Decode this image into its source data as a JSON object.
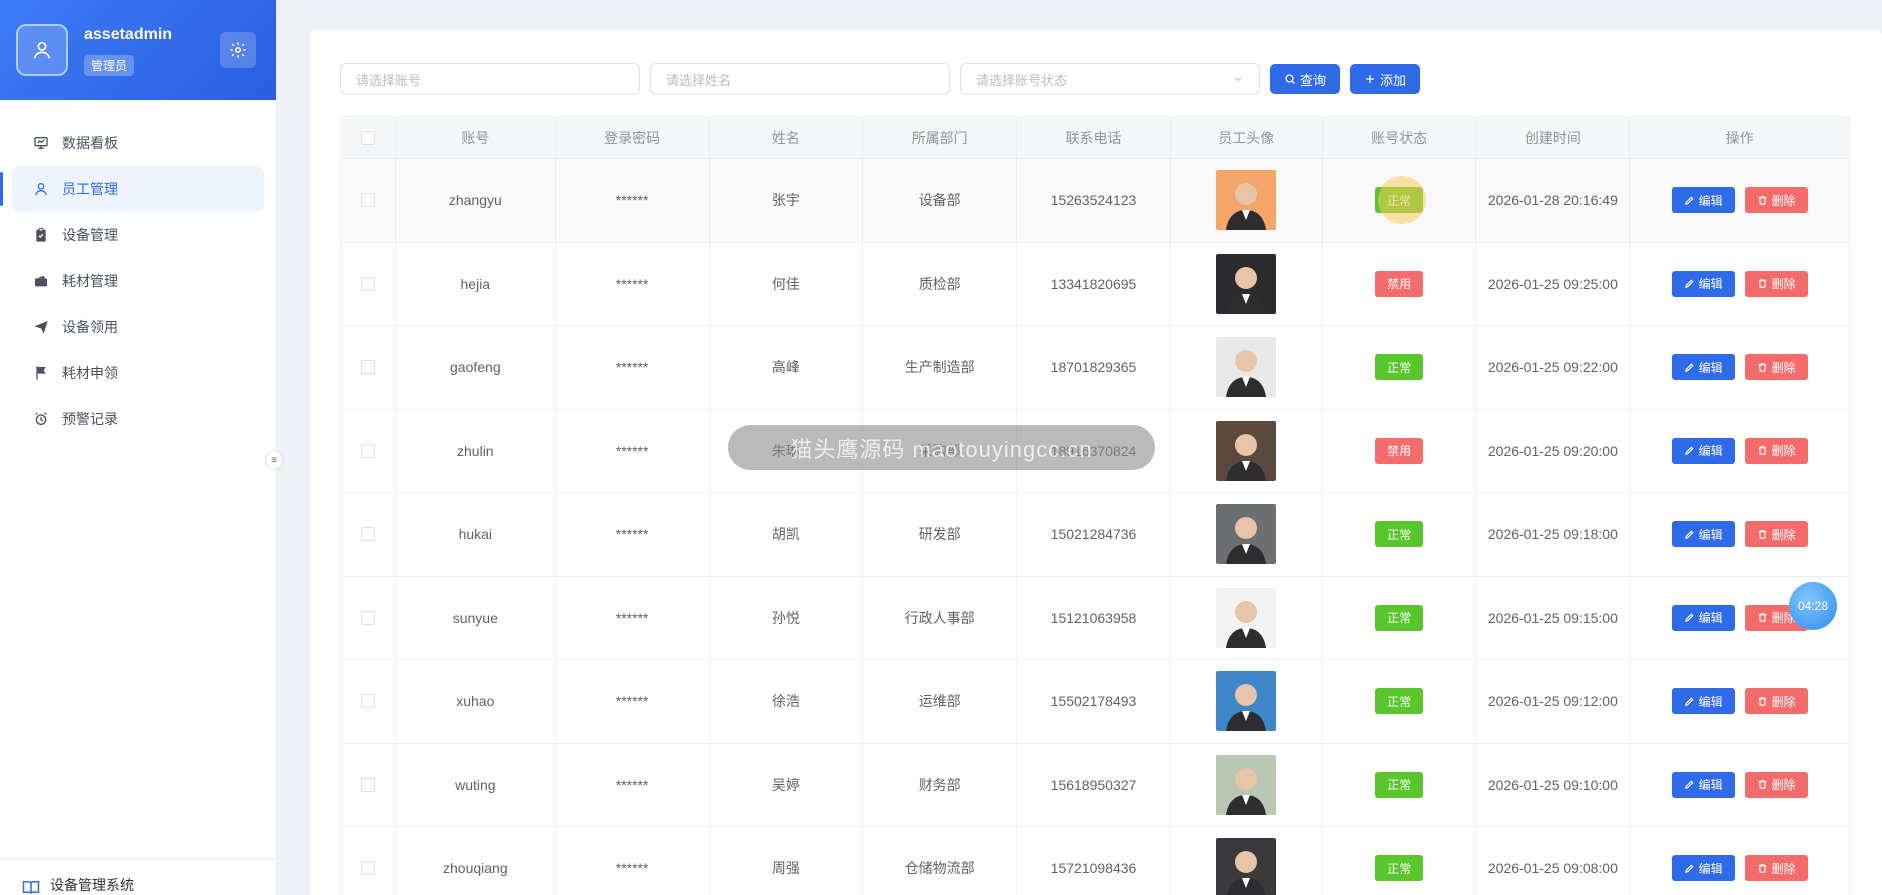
{
  "user": {
    "name": "assetadmin",
    "role": "管理员"
  },
  "menu": [
    {
      "label": "数据看板",
      "icon": "monitor-icon",
      "active": false
    },
    {
      "label": "员工管理",
      "icon": "user-icon",
      "active": true
    },
    {
      "label": "设备管理",
      "icon": "clipboard-icon",
      "active": false
    },
    {
      "label": "耗材管理",
      "icon": "wallet-icon",
      "active": false
    },
    {
      "label": "设备领用",
      "icon": "send-icon",
      "active": false
    },
    {
      "label": "耗材申领",
      "icon": "flag-icon",
      "active": false
    },
    {
      "label": "预警记录",
      "icon": "alarm-clock-icon",
      "active": false
    }
  ],
  "footer": {
    "label": "设备管理系统"
  },
  "filters": {
    "account_placeholder": "请选择账号",
    "name_placeholder": "请选择姓名",
    "status_placeholder": "请选择账号状态",
    "query_label": "查询",
    "add_label": "添加"
  },
  "table": {
    "columns": [
      "账号",
      "登录密码",
      "姓名",
      "所属部门",
      "联系电话",
      "员工头像",
      "账号状态",
      "创建时间",
      "操作"
    ],
    "edit_label": "编辑",
    "delete_label": "删除",
    "rows": [
      {
        "account": "zhangyu",
        "password": "******",
        "name": "张宇",
        "dept": "设备部",
        "phone": "15263524123",
        "status": "正常",
        "created": "2026-01-28 20:16:49",
        "avatar_color": "#f4a56a"
      },
      {
        "account": "hejia",
        "password": "******",
        "name": "何佳",
        "dept": "质检部",
        "phone": "13341820695",
        "status": "禁用",
        "created": "2026-01-25 09:25:00",
        "avatar_color": "#2b2b2e"
      },
      {
        "account": "gaofeng",
        "password": "******",
        "name": "高峰",
        "dept": "生产制造部",
        "phone": "18701829365",
        "status": "正常",
        "created": "2026-01-25 09:22:00",
        "avatar_color": "#e9e9ea"
      },
      {
        "account": "zhulin",
        "password": "******",
        "name": "朱琳",
        "dept": "采购部",
        "phone": "18916370824",
        "status": "禁用",
        "created": "2026-01-25 09:20:00",
        "avatar_color": "#5a4a3e"
      },
      {
        "account": "hukai",
        "password": "******",
        "name": "胡凯",
        "dept": "研发部",
        "phone": "15021284736",
        "status": "正常",
        "created": "2026-01-25 09:18:00",
        "avatar_color": "#6d6e72"
      },
      {
        "account": "sunyue",
        "password": "******",
        "name": "孙悦",
        "dept": "行政人事部",
        "phone": "15121063958",
        "status": "正常",
        "created": "2026-01-25 09:15:00",
        "avatar_color": "#f2f2f2"
      },
      {
        "account": "xuhao",
        "password": "******",
        "name": "徐浩",
        "dept": "运维部",
        "phone": "15502178493",
        "status": "正常",
        "created": "2026-01-25 09:12:00",
        "avatar_color": "#3f86c9"
      },
      {
        "account": "wuting",
        "password": "******",
        "name": "吴婷",
        "dept": "财务部",
        "phone": "15618950327",
        "status": "正常",
        "created": "2026-01-25 09:10:00",
        "avatar_color": "#b9c7b4"
      },
      {
        "account": "zhouqiang",
        "password": "******",
        "name": "周强",
        "dept": "仓储物流部",
        "phone": "15721098436",
        "status": "正常",
        "created": "2026-01-25 09:08:00",
        "avatar_color": "#3a3a3c"
      }
    ]
  },
  "overlay": {
    "watermark": "猫头鹰源码 maotouyingcc.cn",
    "timer": "04:28"
  },
  "colors": {
    "primary": "#2f6ae8",
    "success": "#5ac62d",
    "danger": "#f56c6c"
  }
}
